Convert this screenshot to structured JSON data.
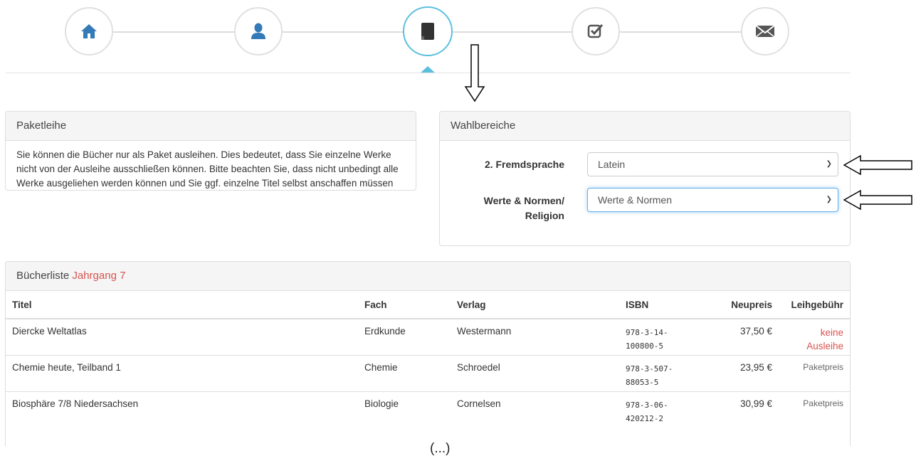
{
  "wizard": {
    "steps": [
      {
        "icon": "home-icon"
      },
      {
        "icon": "user-icon"
      },
      {
        "icon": "book-icon",
        "active": true
      },
      {
        "icon": "check-square-icon"
      },
      {
        "icon": "envelope-icon"
      }
    ],
    "accent_color": "#5bc0de",
    "icon_color": "#337ab7"
  },
  "paketleihe": {
    "heading": "Paketleihe",
    "text": "Sie können die Bücher nur als Paket ausleihen. Dies bedeutet, dass Sie einzelne Werke nicht von der Ausleihe ausschließen können. Bitte beachten Sie, dass nicht unbedingt alle Werke ausgeliehen werden können und Sie ggf. einzelne Titel selbst anschaffen müssen (z. B. Arbeitshefte)."
  },
  "wahlbereiche": {
    "heading": "Wahlbereiche",
    "fremdsprache_label": "2. Fremdsprache",
    "fremdsprache_value": "Latein",
    "werte_label_line1": "Werte & Normen/",
    "werte_label_line2": "Religion",
    "werte_value": "Werte & Normen"
  },
  "buecherliste": {
    "heading_prefix": "Bücherliste",
    "heading_highlight": "Jahrgang 7",
    "columns": [
      "Titel",
      "Fach",
      "Verlag",
      "ISBN",
      "Neupreis",
      "Leihgebühr"
    ],
    "rows": [
      {
        "titel": "Diercke Weltatlas",
        "fach": "Erdkunde",
        "verlag": "Westermann",
        "isbn1": "978-3-14-",
        "isbn2": "100800-5",
        "neupreis": "37,50 €",
        "leih1": "keine",
        "leih2": "Ausleihe",
        "leih_red": true
      },
      {
        "titel": "Chemie heute, Teilband 1",
        "fach": "Chemie",
        "verlag": "Schroedel",
        "isbn1": "978-3-507-",
        "isbn2": "88053-5",
        "neupreis": "23,95 €",
        "leih1": "Paketpreis",
        "leih2": "",
        "leih_red": false
      },
      {
        "titel": "Biosphäre 7/8 Niedersachsen",
        "fach": "Biologie",
        "verlag": "Cornelsen",
        "isbn1": "978-3-06-",
        "isbn2": "420212-2",
        "neupreis": "30,99 €",
        "leih1": "Paketpreis",
        "leih2": "",
        "leih_red": false
      }
    ]
  },
  "ellipsis": "(...)",
  "highlight_color": "#d9534f"
}
